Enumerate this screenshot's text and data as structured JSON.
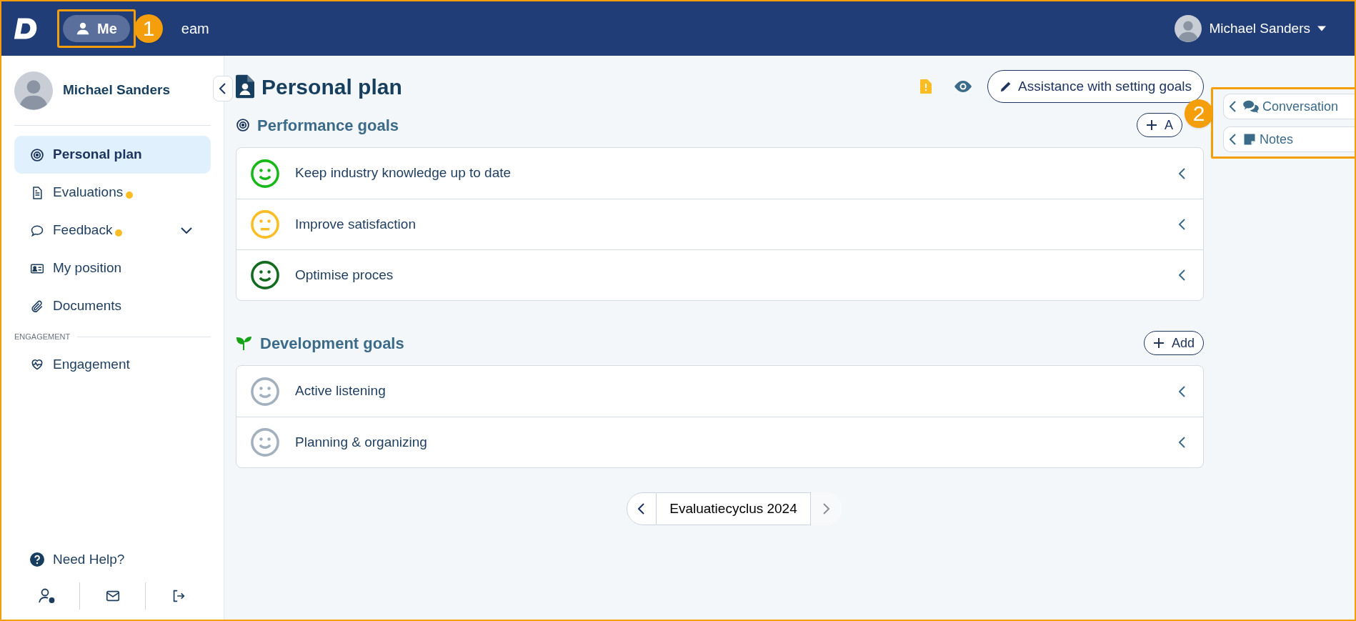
{
  "top_bar": {
    "nav": [
      {
        "label": "Me",
        "selected": true,
        "highlighted": true
      },
      {
        "label": "eam",
        "selected": false,
        "highlighted": false
      }
    ],
    "user_name": "Michael Sanders"
  },
  "annotations": [
    {
      "number": "1"
    },
    {
      "number": "2"
    }
  ],
  "sidebar": {
    "user_name": "Michael Sanders",
    "items": [
      {
        "label": "Personal plan",
        "kind": "target",
        "selected": true,
        "dot": false,
        "expandable": false
      },
      {
        "label": "Evaluations",
        "kind": "document",
        "selected": false,
        "dot": true,
        "expandable": false
      },
      {
        "label": "Feedback",
        "kind": "chat",
        "selected": false,
        "dot": true,
        "expandable": true
      },
      {
        "label": "My position",
        "kind": "card",
        "selected": false,
        "dot": false,
        "expandable": false
      },
      {
        "label": "Documents",
        "kind": "attachment",
        "selected": false,
        "dot": false,
        "expandable": false
      }
    ],
    "section_label": "ENGAGEMENT",
    "section_items": [
      {
        "label": "Engagement",
        "kind": "pulse",
        "selected": false,
        "dot": false,
        "expandable": false
      }
    ],
    "help": "Need Help?"
  },
  "page": {
    "title": "Personal plan",
    "assist_button": "Assistance with setting goals",
    "sections": [
      {
        "title": "Performance goals",
        "kind": "target",
        "add_label": "A",
        "goals": [
          {
            "title": "Keep industry knowledge up to date",
            "kind": "happy",
            "color": "#18b818"
          },
          {
            "title": "Improve satisfaction",
            "kind": "neutral",
            "color": "#fbbd23"
          },
          {
            "title": "Optimise proces",
            "kind": "happy",
            "color": "#136b20"
          }
        ]
      },
      {
        "title": "Development goals",
        "kind": "sprout",
        "add_label": "Add",
        "goals": [
          {
            "title": "Active listening",
            "kind": "happy",
            "color": "#a3b1bf"
          },
          {
            "title": "Planning & organizing",
            "kind": "happy",
            "color": "#a3b1bf"
          }
        ]
      }
    ]
  },
  "side_panel": {
    "highlighted": true,
    "tabs": [
      {
        "label": "Conversation",
        "kind": "chat"
      },
      {
        "label": "Notes",
        "kind": "note"
      }
    ]
  },
  "cycle": {
    "label": "Evaluatiecyclus 2024"
  }
}
